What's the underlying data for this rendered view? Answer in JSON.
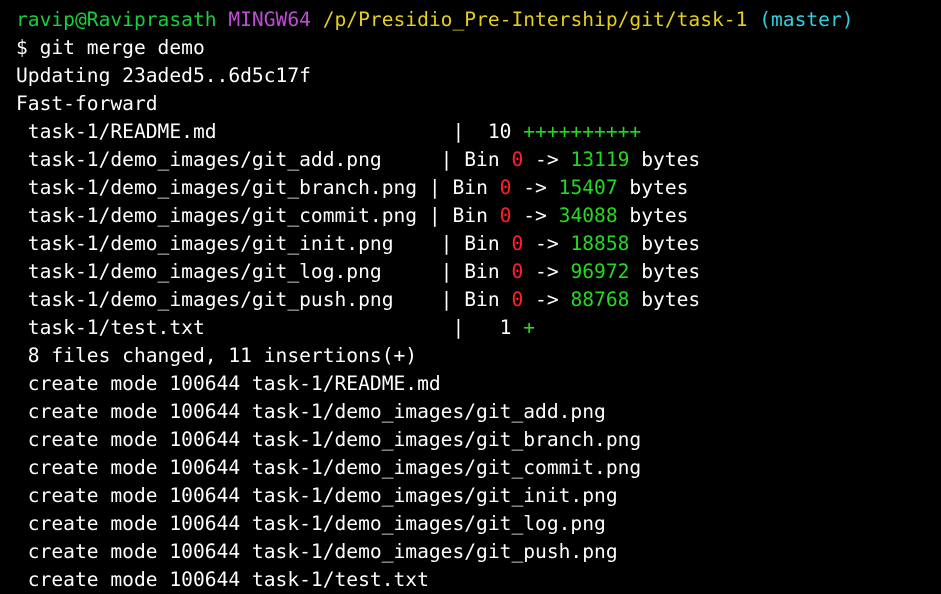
{
  "prompt": {
    "user_host": "ravip@Raviprasath",
    "system": "MINGW64",
    "path": "/p/Presidio_Pre-Intership/git/task-1",
    "branch": "(master)"
  },
  "command": "$ git merge demo",
  "updating": "Updating 23aded5..6d5c17f",
  "fast_forward": "Fast-forward",
  "diffstat": [
    {
      "file": " task-1/README.md                    ",
      "sep": "|  ",
      "count": "10",
      "plus": "++++++++++"
    },
    {
      "file": " task-1/demo_images/git_add.png     ",
      "sep": "| Bin ",
      "from": "0",
      "arrow": " -> ",
      "to": "13119",
      "unit": " bytes"
    },
    {
      "file": " task-1/demo_images/git_branch.png ",
      "sep": "| Bin ",
      "from": "0",
      "arrow": " -> ",
      "to": "15407",
      "unit": " bytes"
    },
    {
      "file": " task-1/demo_images/git_commit.png ",
      "sep": "| Bin ",
      "from": "0",
      "arrow": " -> ",
      "to": "34088",
      "unit": " bytes"
    },
    {
      "file": " task-1/demo_images/git_init.png    ",
      "sep": "| Bin ",
      "from": "0",
      "arrow": " -> ",
      "to": "18858",
      "unit": " bytes"
    },
    {
      "file": " task-1/demo_images/git_log.png     ",
      "sep": "| Bin ",
      "from": "0",
      "arrow": " -> ",
      "to": "96972",
      "unit": " bytes"
    },
    {
      "file": " task-1/demo_images/git_push.png    ",
      "sep": "| Bin ",
      "from": "0",
      "arrow": " -> ",
      "to": "88768",
      "unit": " bytes"
    },
    {
      "file": " task-1/test.txt                     ",
      "sep": "|   ",
      "count": "1",
      "plus": "+"
    }
  ],
  "summary": " 8 files changed, 11 insertions(+)",
  "create_lines": [
    " create mode 100644 task-1/README.md",
    " create mode 100644 task-1/demo_images/git_add.png",
    " create mode 100644 task-1/demo_images/git_branch.png",
    " create mode 100644 task-1/demo_images/git_commit.png",
    " create mode 100644 task-1/demo_images/git_init.png",
    " create mode 100644 task-1/demo_images/git_log.png",
    " create mode 100644 task-1/demo_images/git_push.png",
    " create mode 100644 task-1/test.txt"
  ],
  "colors": {
    "background": "#000000",
    "user_host": "#13d13b",
    "system": "#c04bd8",
    "path": "#e5cf1a",
    "branch": "#2fd0e0",
    "removed": "#ff1f2b",
    "added": "#1fdc1f"
  }
}
